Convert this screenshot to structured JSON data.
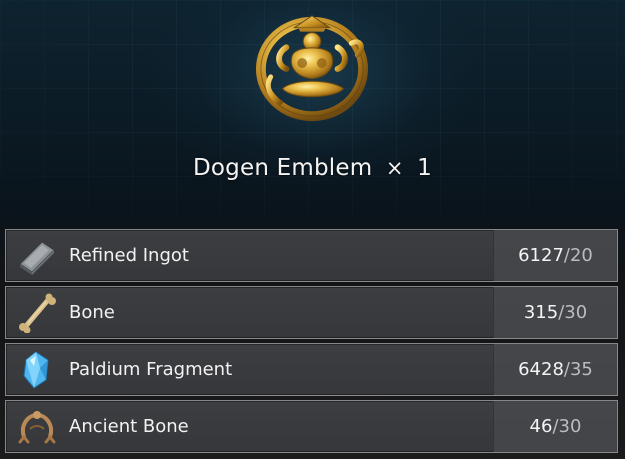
{
  "item": {
    "name": "Dogen Emblem",
    "multiplier": "×",
    "count": "1",
    "icon": "gold-emblem-icon"
  },
  "materials": [
    {
      "name": "Refined Ingot",
      "have": "6127",
      "need": "20",
      "icon": "ingot-icon"
    },
    {
      "name": "Bone",
      "have": "315",
      "need": "30",
      "icon": "bone-icon"
    },
    {
      "name": "Paldium Fragment",
      "have": "6428",
      "need": "35",
      "icon": "crystal-icon"
    },
    {
      "name": "Ancient Bone",
      "have": "46",
      "need": "30",
      "icon": "ancient-bone-icon"
    }
  ],
  "separator": "/",
  "colors": {
    "accent_gold": "#d4a437",
    "row_bg": "#3a3b3e",
    "need_text": "#b9bcc0"
  }
}
